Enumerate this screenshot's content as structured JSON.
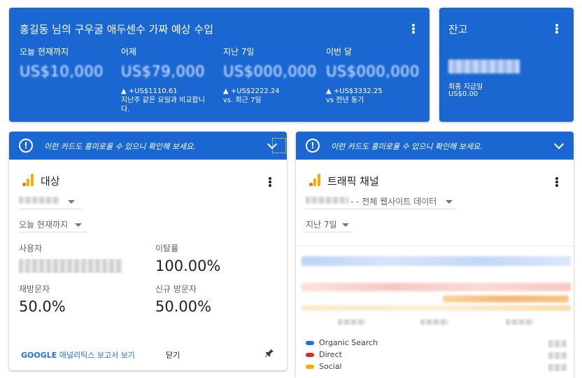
{
  "estimated": {
    "title": "홍길동 님의 구우굴 애두센수 가짜 예상 수입",
    "metrics": [
      {
        "label": "오늘 현재까지",
        "value": "US$10,000",
        "delta": "",
        "sub": ""
      },
      {
        "label": "어제",
        "value": "US$79,000",
        "delta": "▲ +US$1110.61",
        "sub": "지난주 같은 요일과 비교합니다."
      },
      {
        "label": "지난 7일",
        "value": "US$000,000",
        "delta": "▲ +US$2222.24",
        "sub": "vs. 최근 7일"
      },
      {
        "label": "이번 달",
        "value": "US$000,000",
        "delta": "▲ +US$3332.25",
        "sub": "vs 전년 동기"
      }
    ]
  },
  "balance": {
    "title": "잔고",
    "last_payment_label": "최종 지급일",
    "last_payment_value": "US$0.00"
  },
  "suggestion_text": "이런 카드도 흥미로울 수 있으니 확인해 보세요.",
  "audience_card": {
    "title": "대상",
    "property_dropdown": "",
    "period_dropdown": "오늘 현재까지",
    "metrics": [
      {
        "label": "사용자",
        "value": ""
      },
      {
        "label": "이탈률",
        "value": "100.00%"
      },
      {
        "label": "재방문자",
        "value": "50.0%"
      },
      {
        "label": "신규 방문자",
        "value": "50.00%"
      }
    ],
    "report_link_bold": "GOOGLE",
    "report_link_rest": " 애널리틱스 보고서 보기",
    "close_label": "닫기"
  },
  "traffic_card": {
    "title": "트래픽 채널",
    "property_dropdown": "- - 전체 웹사이트 데이터",
    "period_dropdown": "지난 7일",
    "legend": [
      {
        "name": "Organic Search",
        "color": "#1a73e8"
      },
      {
        "name": "Direct",
        "color": "#d93025"
      },
      {
        "name": "Social",
        "color": "#f9ab00"
      }
    ]
  },
  "colors": {
    "primary_blue": "#1a67d2",
    "link_blue": "#1a73e8",
    "ga_orange": "#f9ab00"
  }
}
